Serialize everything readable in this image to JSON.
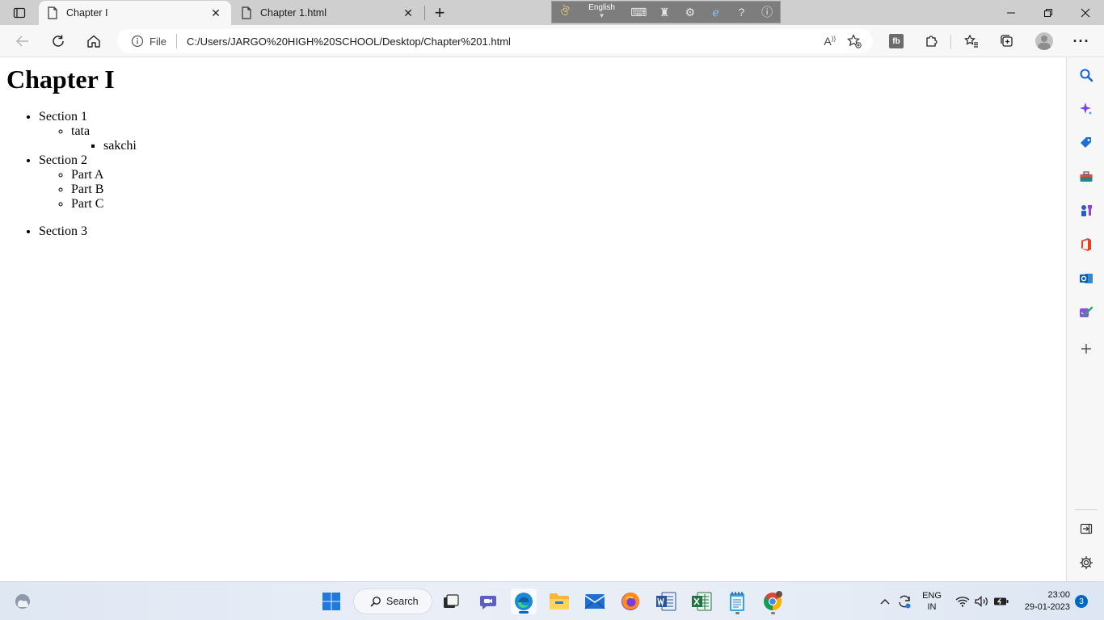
{
  "tabs": [
    {
      "title": "Chapter I",
      "active": true
    },
    {
      "title": "Chapter 1.html",
      "active": false
    }
  ],
  "language_bar": {
    "language": "English"
  },
  "address_bar": {
    "scheme_label": "File",
    "url": "C:/Users/JARGO%20HIGH%20SCHOOL/Desktop/Chapter%201.html"
  },
  "page": {
    "heading": "Chapter I",
    "sections": [
      {
        "label": "Section 1",
        "children": [
          {
            "label": "tata",
            "children": [
              {
                "label": "sakchi"
              }
            ]
          }
        ]
      },
      {
        "label": "Section 2",
        "children": [
          {
            "label": "Part A"
          },
          {
            "label": "Part B"
          },
          {
            "label": "Part C"
          }
        ]
      },
      {
        "label": "Section 3"
      }
    ]
  },
  "taskbar": {
    "search_label": "Search",
    "language": {
      "line1": "ENG",
      "line2": "IN"
    },
    "clock": {
      "time": "23:00",
      "date": "29-01-2023"
    },
    "notification_count": "3"
  },
  "colors": {
    "accent": "#0067c0",
    "tabstrip": "#cfcfcf",
    "toolbar": "#f7f7f7"
  }
}
